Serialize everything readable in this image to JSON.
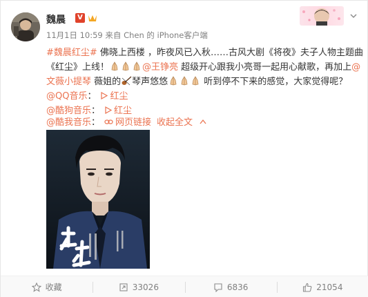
{
  "post": {
    "username": "魏晨",
    "verified_label": "V",
    "time": "11月1日 10:59",
    "source_prefix": "来自",
    "source": "Chen 的 iPhone客户端"
  },
  "content": {
    "hashtag": "#魏晨红尘#",
    "line1_text": " 佛晓上西楼 ，昨夜风已入秋……古风大剧《将夜》夫子人物主题曲",
    "line2_text_a": "《红尘》上线！",
    "mention_1": "@王铮亮",
    "line2_text_b": " 超级开心跟我小亮哥一起用心献歌，再加上",
    "mention_2_part1": "@",
    "mention_2_part2": "文薇小提琴",
    "line3_text_a": " 薇姐的",
    "line3_text_b": "琴声悠悠",
    "line3_text_c": " 听到停不下来的感觉，大家觉得呢？"
  },
  "music_links": [
    {
      "platform": "@QQ音乐",
      "sep": "：",
      "link": "红尘"
    },
    {
      "platform": "@酷狗音乐",
      "sep": "：",
      "link": "红尘"
    }
  ],
  "web_link": {
    "platform": "@酷我音乐",
    "sep": "：",
    "link": "网页链接",
    "expand": "收起全文"
  },
  "footer": {
    "favorite": "收藏",
    "repost": "33026",
    "comment": "6836",
    "like": "21054"
  },
  "colors": {
    "link": "#eb7350",
    "text": "#333333",
    "meta": "#808080",
    "verified": "#e0422b"
  },
  "icons": [
    "verified-icon",
    "vip-icon",
    "chevron-down-icon",
    "play-icon",
    "link-icon",
    "up-icon",
    "star-icon",
    "repost-icon",
    "comment-icon",
    "thumbs-up-icon",
    "pray-emoji",
    "violin-emoji"
  ]
}
